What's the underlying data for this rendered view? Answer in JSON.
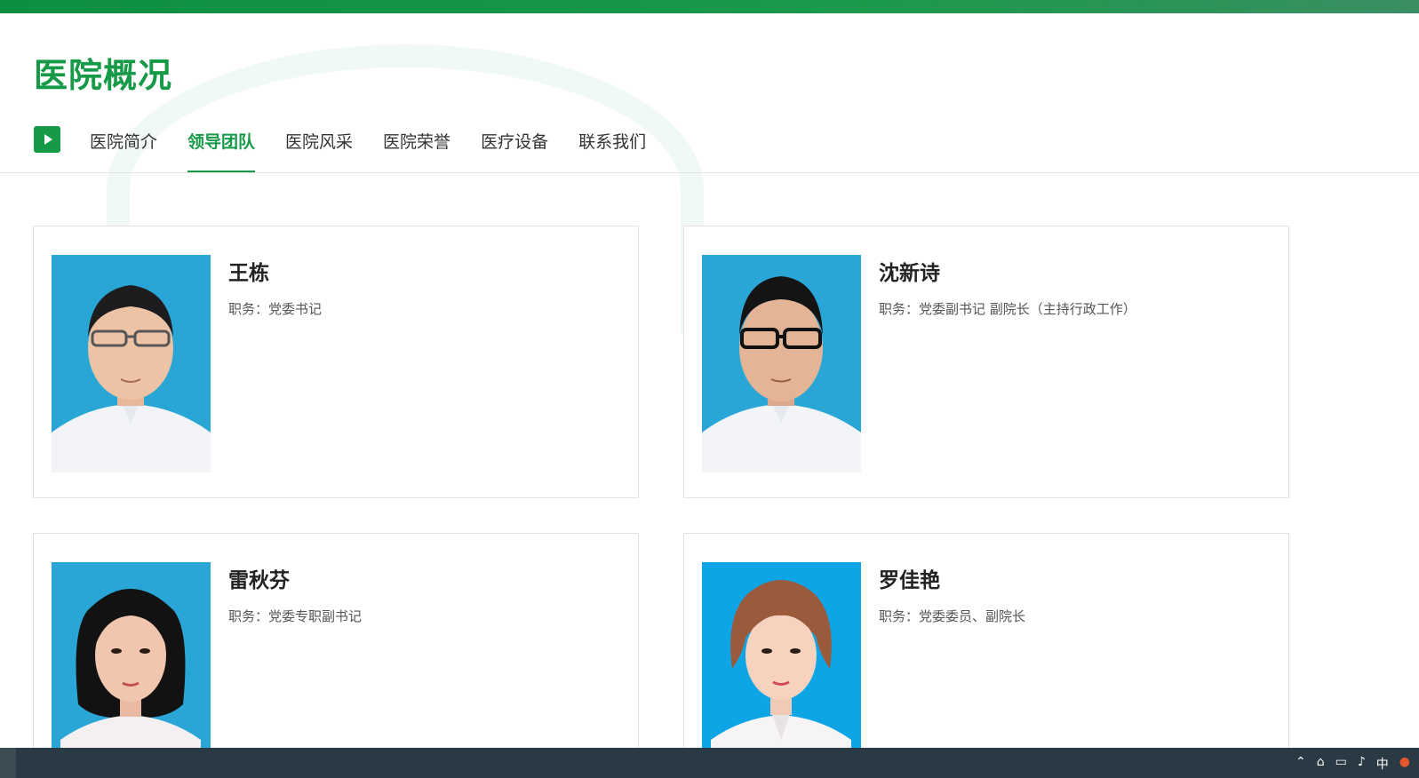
{
  "header": {
    "title": "医院概况"
  },
  "nav": {
    "tabs": [
      {
        "label": "医院简介"
      },
      {
        "label": "领导团队",
        "active": true
      },
      {
        "label": "医院风采"
      },
      {
        "label": "医院荣誉"
      },
      {
        "label": "医疗设备"
      },
      {
        "label": "联系我们"
      }
    ]
  },
  "leaders": [
    {
      "name": "王栋",
      "role": "职务：党委书记"
    },
    {
      "name": "沈新诗",
      "role": "职务：党委副书记 副院长（主持行政工作）"
    },
    {
      "name": "雷秋芬",
      "role": "职务：党委专职副书记"
    },
    {
      "name": "罗佳艳",
      "role": "职务：党委委员、副院长"
    }
  ],
  "colors": {
    "brand": "#169a48",
    "photo_bg": "#2aa6d6",
    "photo_bg_alt": "#0ea5e6"
  },
  "taskbar": {
    "icons": [
      "chevron-up-icon",
      "network-icon",
      "display-icon",
      "speaker-icon",
      "ime-icon",
      "app-icon"
    ],
    "ime_label": "中"
  }
}
